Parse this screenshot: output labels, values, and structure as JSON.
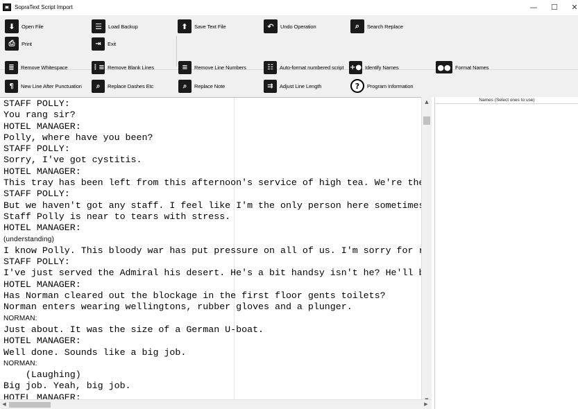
{
  "window": {
    "title": "SopraText Script Import",
    "minimize": "—",
    "maximize": "☐",
    "close": "✕"
  },
  "toolbar": {
    "row1": [
      {
        "label": "Open File",
        "icon": "download-icon",
        "glyph": "⬇"
      },
      {
        "label": "Load Backup",
        "icon": "list-icon",
        "glyph": "☰"
      },
      {
        "label": "Save Text File",
        "icon": "upload-icon",
        "glyph": "⬆"
      },
      {
        "label": "Undo Operation",
        "icon": "undo-icon",
        "glyph": "↶"
      },
      {
        "label": "Search Replace",
        "icon": "search-icon",
        "glyph": "⌕"
      }
    ],
    "row2": [
      {
        "label": "Print",
        "icon": "printer-icon",
        "glyph": "⎙"
      },
      {
        "label": "Exit",
        "icon": "exit-icon",
        "glyph": "⇥"
      }
    ],
    "row3": [
      {
        "label": "Remove Whitespace",
        "icon": "align-icon",
        "glyph": "≣"
      },
      {
        "label": "Remove Blank Lines",
        "icon": "numbered-list-icon",
        "glyph": "⋮≡"
      },
      {
        "label": "Remove Line Numbers",
        "icon": "remove-numbers-icon",
        "glyph": "≡"
      },
      {
        "label": "Auto-format numbered script",
        "icon": "format-list-icon",
        "glyph": "☷"
      },
      {
        "label": "Identify Names",
        "icon": "add-person-icon",
        "glyph": "+●"
      },
      {
        "label": "Format Names",
        "icon": "people-icon",
        "glyph": "●●"
      }
    ],
    "row4": [
      {
        "label": "New Line After Punctuation",
        "icon": "pilcrow-icon",
        "glyph": "¶"
      },
      {
        "label": "Replace Dashes Etc",
        "icon": "replace-icon",
        "glyph": "⌕"
      },
      {
        "label": "Replace Note",
        "icon": "replace-note-icon",
        "glyph": "⌕"
      },
      {
        "label": "Adjust Line Length",
        "icon": "wrap-icon",
        "glyph": "⇉"
      },
      {
        "label": "Program Information",
        "icon": "help-icon",
        "glyph": "?"
      }
    ]
  },
  "names_panel": {
    "header": "Names (Select ones to use)"
  },
  "editor": {
    "lines": [
      "STAFF POLLY:",
      "You rang sir?",
      "HOTEL MANAGER:",
      "Polly, where have you been?",
      "STAFF POLLY:",
      "Sorry, I've got cystitis.",
      "HOTEL MANAGER:",
      "This tray has been left from this afternoon's service of high tea. We're the",
      "STAFF POLLY:",
      "But we haven't got any staff. I feel like I'm the only person here sometimes.",
      "Staff Polly is near to tears with stress.",
      "HOTEL MANAGER:",
      "(understanding)",
      "I know Polly. This bloody war has put pressure on all of us. I'm sorry for ra",
      "STAFF POLLY:",
      "I've just served the Admiral his desert. He's a bit handsy isn't he? He'll be",
      "HOTEL MANAGER:",
      "Has Norman cleared out the blockage in the first floor gents toilets?",
      "Norman enters wearing wellingtons, rubber gloves and a plunger.",
      "NORMAN:",
      "Just about. It was the size of a German U-boat.",
      "HOTEL MANAGER:",
      "Well done. Sounds like a big job.",
      "NORMAN:",
      "    (Laughing)",
      "Big job. Yeah, big job.",
      "HOTEL MANAGER:"
    ]
  },
  "scrollbars": {
    "up": "▲",
    "down": "▼",
    "left": "◀",
    "right": "▶"
  }
}
